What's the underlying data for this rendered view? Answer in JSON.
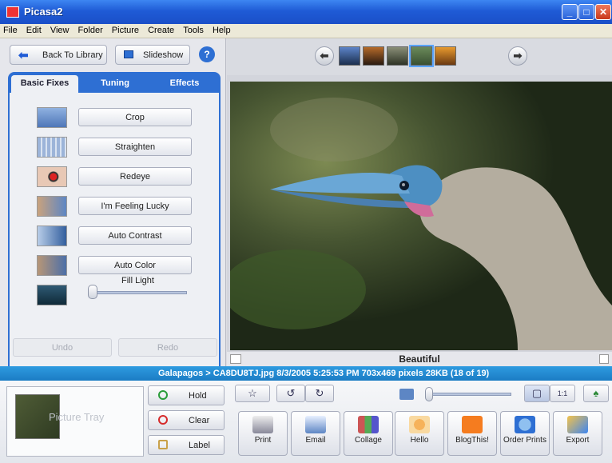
{
  "window": {
    "title": "Picasa2"
  },
  "menu": [
    "File",
    "Edit",
    "View",
    "Folder",
    "Picture",
    "Create",
    "Tools",
    "Help"
  ],
  "toolbar": {
    "back_label": "Back To Library",
    "slideshow_label": "Slideshow",
    "help_label": "?"
  },
  "tabs": [
    "Basic Fixes",
    "Tuning",
    "Effects"
  ],
  "active_tab": "Basic Fixes",
  "fixes": [
    "Crop",
    "Straighten",
    "Redeye",
    "I'm Feeling Lucky",
    "Auto Contrast",
    "Auto Color"
  ],
  "fill_light": {
    "label": "Fill Light",
    "value": 0
  },
  "edit": {
    "undo": "Undo",
    "redo": "Redo"
  },
  "photo": {
    "caption": "Beautiful"
  },
  "status": {
    "text": "Galapagos > CA8DU8TJ.jpg   8/3/2005 5:25:53 PM   703x469 pixels   28KB   (18 of 19)"
  },
  "tray": {
    "label": "Picture Tray",
    "hold": "Hold",
    "clear": "Clear",
    "label_btn": "Label"
  },
  "view_toggle": {
    "fit": "▢",
    "actual": "1:1"
  },
  "actions": [
    "Print",
    "Email",
    "Collage",
    "Hello",
    "BlogThis!",
    "Order Prints",
    "Export"
  ],
  "colors": {
    "titlebar": "#1f5bd6",
    "tab_blue": "#2e6fd3",
    "status": "#1b7cc4",
    "hold_icon": "#2a9d3a",
    "clear_icon": "#d62b2b"
  }
}
